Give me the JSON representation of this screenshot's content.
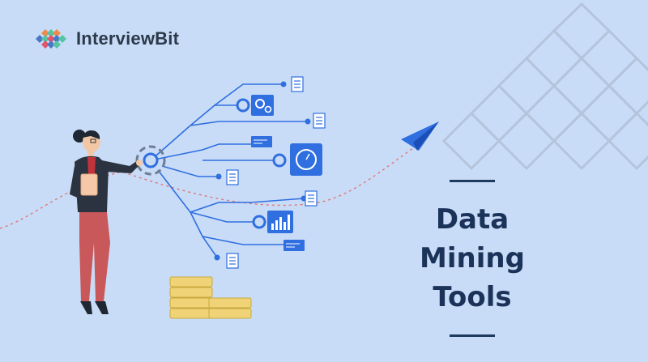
{
  "brand": {
    "name": "InterviewBit",
    "colors": {
      "logo_green": "#56c3a2",
      "logo_orange": "#f08a4b",
      "logo_blue": "#4a77c4",
      "logo_red": "#e4546a"
    }
  },
  "headline": {
    "line1": "Data Mining",
    "line2": "Tools"
  },
  "colors": {
    "background": "#c9dcf7",
    "title": "#1b3358",
    "accent_blue": "#2f6fe0",
    "node_blue": "#3a74e6",
    "grid_line": "#b4c4dc"
  },
  "icons": [
    "logo-diamond-icon",
    "paper-plane-icon",
    "gears-icon",
    "gauge-icon",
    "bar-chart-icon",
    "document-icon",
    "coin-stack-icon"
  ]
}
